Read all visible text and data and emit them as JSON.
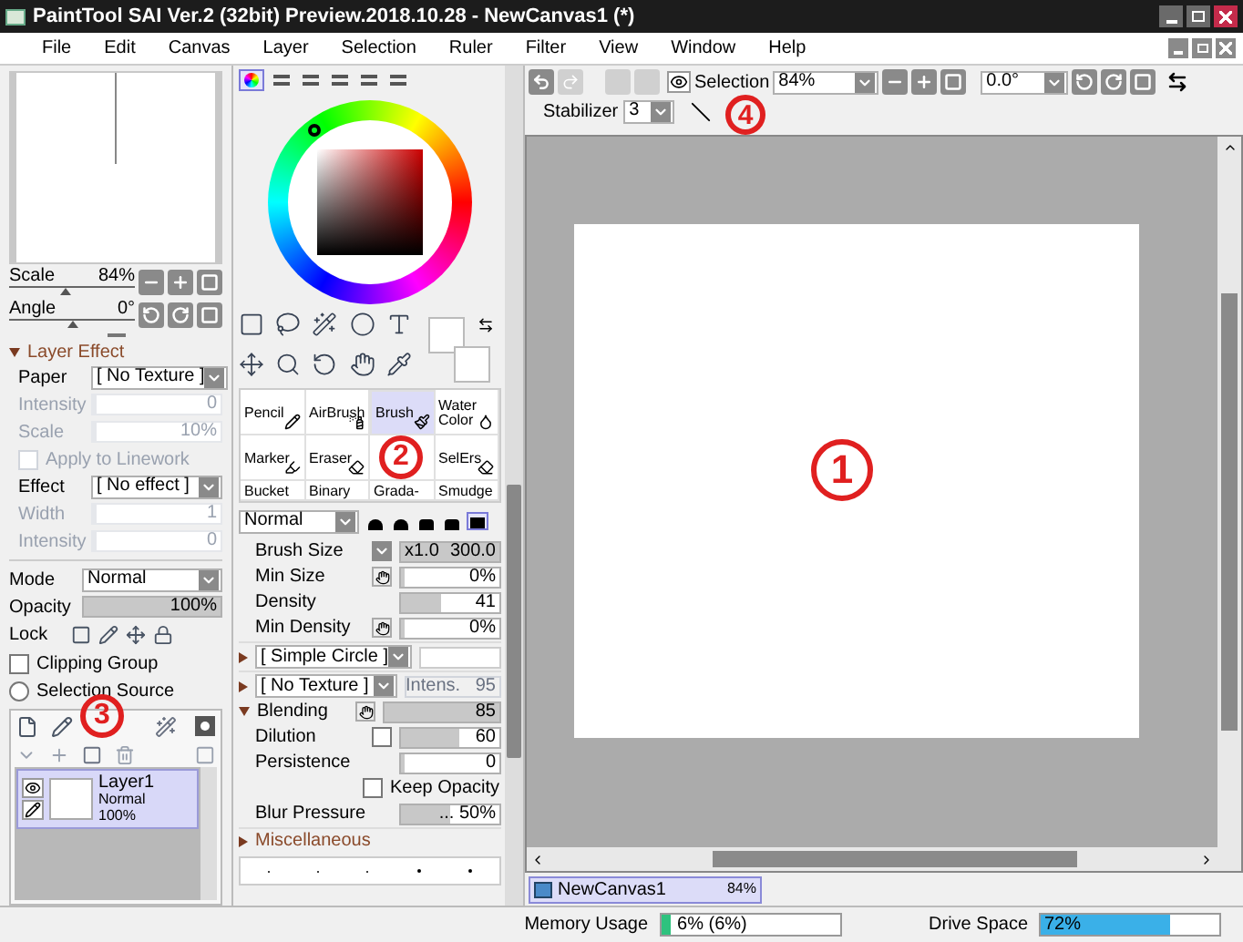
{
  "window": {
    "title": "PaintTool SAI Ver.2 (32bit) Preview.2018.10.28 - NewCanvas1 (*)"
  },
  "menu": [
    "File",
    "Edit",
    "Canvas",
    "Layer",
    "Selection",
    "Ruler",
    "Filter",
    "View",
    "Window",
    "Help"
  ],
  "navigator": {
    "rows": [
      {
        "label": "Scale",
        "value": "84%",
        "level": 0.45
      },
      {
        "label": "Angle",
        "value": "0°",
        "level": 0.5
      }
    ]
  },
  "layer_effect": {
    "title": "Layer Effect",
    "expanded": true,
    "rows": [
      {
        "kind": "select",
        "label": "Paper",
        "value": "[ No Texture ]",
        "disabled": false
      },
      {
        "kind": "slider",
        "label": "Intensity",
        "value": "0",
        "level": 0,
        "disabled": true
      },
      {
        "kind": "slider",
        "label": "Scale",
        "value": "10%",
        "level": 0.03,
        "disabled": true
      },
      {
        "kind": "checkbox",
        "label": "Apply to Linework",
        "checked": false,
        "disabled": true
      },
      {
        "kind": "select",
        "label": "Effect",
        "value": "[ No effect ]",
        "disabled": false
      },
      {
        "kind": "slider",
        "label": "Width",
        "value": "1",
        "level": 0.03,
        "disabled": true
      },
      {
        "kind": "slider",
        "label": "Intensity",
        "value": "0",
        "level": 0,
        "disabled": true
      }
    ]
  },
  "layer_props": {
    "rows": [
      {
        "kind": "select",
        "label": "Mode",
        "value": "Normal",
        "disabled": false
      },
      {
        "kind": "slider",
        "label": "Opacity",
        "value": "100%",
        "level": 1,
        "disabled": false
      },
      {
        "kind": "lock",
        "label": "Lock"
      },
      {
        "kind": "checkbox",
        "label": "Clipping Group",
        "checked": false,
        "disabled": false
      },
      {
        "kind": "radio",
        "label": "Selection Source",
        "checked": false,
        "disabled": false
      }
    ]
  },
  "layers": [
    {
      "name": "Layer1",
      "mode": "Normal",
      "opacity": "100%",
      "selected": true
    }
  ],
  "color_modes": [
    {
      "selected": true
    },
    {
      "selected": false
    },
    {
      "selected": false
    },
    {
      "selected": false
    },
    {
      "selected": false
    },
    {
      "selected": false
    }
  ],
  "brushes": [
    {
      "label": "Pencil",
      "selected": false
    },
    {
      "label": "AirBrush",
      "selected": false
    },
    {
      "label": "Brush",
      "selected": true
    },
    {
      "label": "Water Color",
      "selected": false
    },
    {
      "label": "Marker",
      "selected": false
    },
    {
      "label": "Eraser",
      "selected": false
    },
    {
      "selected": false
    },
    {
      "label": "SelErs",
      "selected": false
    },
    {
      "label": "Bucket",
      "selected": false
    },
    {
      "label": "Binary",
      "selected": false
    },
    {
      "label": "Grada-",
      "selected": false
    },
    {
      "label": "Smudge",
      "selected": false
    }
  ],
  "brush_mode": "Normal",
  "brush_shapes": [
    {
      "selected": false
    },
    {
      "selected": false
    },
    {
      "selected": false
    },
    {
      "selected": false
    },
    {
      "selected": true
    }
  ],
  "brush_settings": [
    {
      "kind": "slider",
      "label": "Brush Size",
      "prefix": "x1.0",
      "value": "300.0",
      "level": 1,
      "dropdown": true
    },
    {
      "kind": "slider",
      "label": "Min Size",
      "value": "0%",
      "level": 0,
      "pressure": true
    },
    {
      "kind": "slider",
      "label": "Density",
      "value": "41",
      "level": 0.41
    },
    {
      "kind": "slider",
      "label": "Min Density",
      "value": "0%",
      "level": 0,
      "pressure": true
    },
    {
      "kind": "select",
      "value": "[ Simple Circle ]",
      "expanded": false
    },
    {
      "kind": "select",
      "value": "[ No Texture ]",
      "expanded": false,
      "extra": "Intens.   95"
    },
    {
      "kind": "slider",
      "label": "Blending",
      "value": "85",
      "level": 1,
      "pressure": true,
      "expanded": true
    },
    {
      "kind": "slider",
      "label": "Dilution",
      "value": "60",
      "level": 0.6,
      "checked": false
    },
    {
      "kind": "slider",
      "label": "Persistence",
      "value": "0",
      "level": 0
    },
    {
      "kind": "checkbox",
      "label": "Keep Opacity",
      "checked": false
    },
    {
      "kind": "slider",
      "label": "Blur Pressure",
      "value": "... 50%",
      "level": 0.5
    },
    {
      "kind": "section",
      "label": "Miscellaneous",
      "expanded": false
    }
  ],
  "canvas_toolbar": {
    "selection_label": "Selection",
    "zoom": "84%",
    "angle": "0.0°",
    "stabilizer_label": "Stabilizer",
    "stabilizer": "3"
  },
  "canvas_tabs": [
    {
      "name": "NewCanvas1",
      "zoom": "84%",
      "selected": true
    }
  ],
  "status_bar": {
    "memory": {
      "label": "Memory Usage",
      "value": "6% (6%)",
      "level": 0.06
    },
    "drive": {
      "label": "Drive Space",
      "value": "72%",
      "level": 0.72
    }
  },
  "annotations": [
    {
      "label": "1"
    },
    {
      "label": "2"
    },
    {
      "label": "3"
    },
    {
      "label": "4"
    }
  ]
}
